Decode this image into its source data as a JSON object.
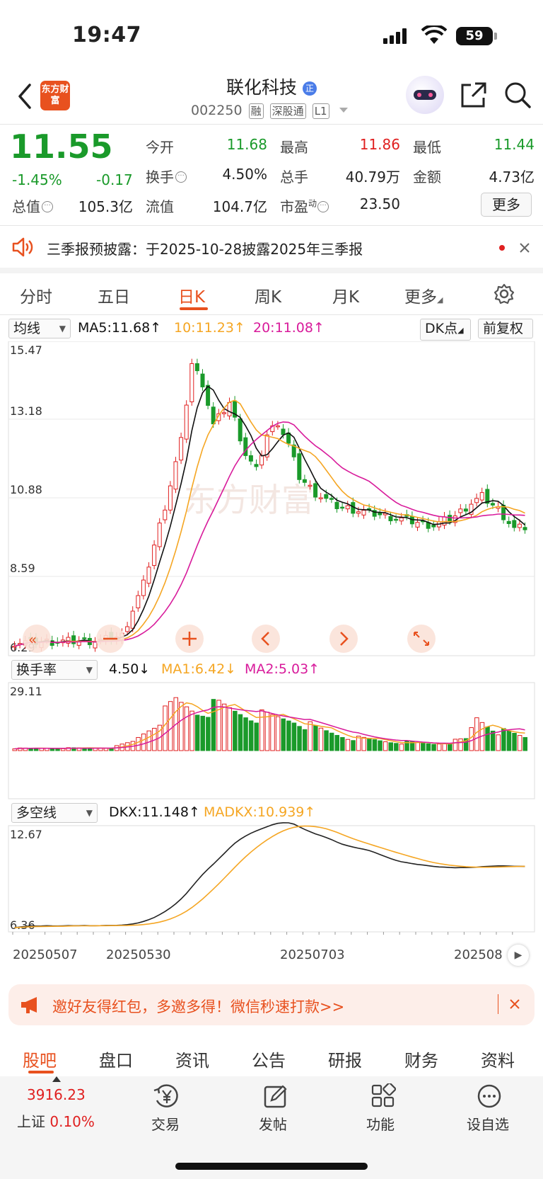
{
  "status_bar": {
    "time": "19:47",
    "battery": "59"
  },
  "header": {
    "logo_text": "东方财富",
    "stock_name": "联化科技",
    "stock_code": "002250",
    "tags": [
      "融",
      "深股通",
      "L1"
    ],
    "badge": "正"
  },
  "quote": {
    "price": "11.55",
    "change_pct": "-1.45%",
    "change": "-0.17",
    "open_label": "今开",
    "open": "11.68",
    "high_label": "最高",
    "high": "11.86",
    "low_label": "最低",
    "low": "11.44",
    "turnover_label": "换手",
    "turnover": "4.50%",
    "volume_label": "总手",
    "volume": "40.79万",
    "amount_label": "金额",
    "amount": "4.73亿",
    "total_cap_label": "总值",
    "total_cap": "105.3亿",
    "float_cap_label": "流值",
    "float_cap": "104.7亿",
    "pe_label": "市盈",
    "pe_sup": "动",
    "pe": "23.50",
    "more": "更多"
  },
  "notice": {
    "text": "三季报预披露：于2025-10-28披露2025年三季报"
  },
  "period_tabs": [
    "分时",
    "五日",
    "日K",
    "周K",
    "月K",
    "更多"
  ],
  "active_period": "日K",
  "kline": {
    "indicator_select": "均线",
    "ma5": "MA5:11.68↑",
    "ma10": "10:11.23↑",
    "ma20": "20:11.08↑",
    "dk_select": "DK点",
    "adjust": "前复权",
    "y_labels": [
      "15.47",
      "13.18",
      "10.88",
      "8.59",
      "6.29"
    ]
  },
  "turnover_panel": {
    "select": "换手率",
    "value": "4.50↓",
    "ma1": "MA1:6.42↓",
    "ma2": "MA2:5.03↑",
    "y_max": "29.11"
  },
  "dkx_panel": {
    "select": "多空线",
    "dkx": "DKX:11.148↑",
    "madkx": "MADKX:10.939↑",
    "y_max": "12.67",
    "y_min": "6.36"
  },
  "dates": [
    "20250507",
    "20250530",
    "20250703",
    "202508"
  ],
  "colors": {
    "up": "#e02020",
    "down": "#1a9a2a",
    "accent": "#e8511f",
    "ma5": "#111111",
    "ma10": "#f5a623",
    "ma20": "#d81b9b"
  },
  "chart_data": {
    "type": "candlestick",
    "series": [
      {
        "name": "MA5",
        "values": [
          11.68
        ]
      },
      {
        "name": "10",
        "values": [
          11.23
        ]
      },
      {
        "name": "20",
        "values": [
          11.08
        ]
      }
    ],
    "ylim": [
      6.29,
      15.47
    ]
  },
  "promo": {
    "text": "邀好友得红包，多邀多得！微信秒速打款>>"
  },
  "bottom_tabs": [
    "股吧",
    "盘口",
    "资讯",
    "公告",
    "研报",
    "财务",
    "资料"
  ],
  "active_bottom_tab": "股吧",
  "bottom_bar": {
    "index_value": "3916.23",
    "index_name": "上证",
    "index_change": "0.10%",
    "trade": "交易",
    "post": "发帖",
    "func": "功能",
    "watch": "设自选"
  }
}
